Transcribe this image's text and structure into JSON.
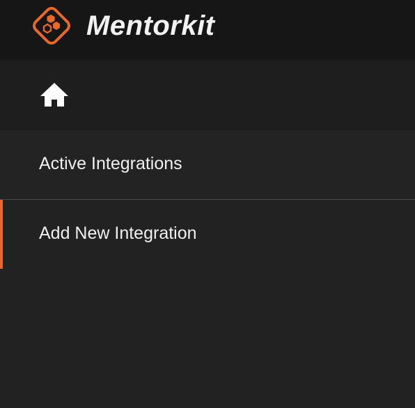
{
  "app": {
    "brand_name": "Mentorkit",
    "logo_icon": "mentorkit-hexagon-logo",
    "accent_color": "#e8682a"
  },
  "home": {
    "icon": "home-icon"
  },
  "nav": {
    "items": [
      {
        "label": "Active Integrations",
        "active": false
      },
      {
        "label": "Add New Integration",
        "active": true
      }
    ]
  }
}
